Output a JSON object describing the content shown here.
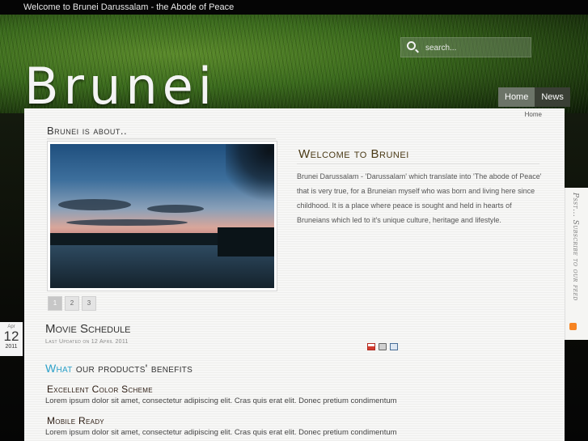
{
  "topbar": {
    "welcome": "Welcome to Brunei Darussalam - the Abode of Peace"
  },
  "header": {
    "logo": "Brunei"
  },
  "search": {
    "placeholder": "search..."
  },
  "nav": {
    "items": [
      {
        "label": "Home"
      },
      {
        "label": "News"
      }
    ]
  },
  "breadcrumb": {
    "current": "Home"
  },
  "about": {
    "title": "Brunei is about..",
    "pages": [
      "1",
      "2",
      "3"
    ]
  },
  "welcome": {
    "title": "Welcome to Brunei",
    "text": "Brunei Darussalam - 'Darussalam' which translate into 'The abode of Peace' that is very true, for a Bruneian myself who was born and living here since childhood. It is a place where peace is sought and held in hearts of Bruneians which led to it's unique culture, heritage and lifestyle."
  },
  "article": {
    "date": {
      "month": "Apr",
      "day": "12",
      "year": "2011"
    },
    "title": "Movie Schedule",
    "updated": "Last Updated on 12 April 2011",
    "icons": [
      "pdf-icon",
      "print-icon",
      "email-icon"
    ]
  },
  "benefits": {
    "title_accent": "What",
    "title_rest": " our products' benefits",
    "features": [
      {
        "title": "Excellent Color Scheme",
        "text": "Lorem ipsum dolor sit amet, consectetur adipiscing elit. Cras quis erat elit. Donec pretium condimentum"
      },
      {
        "title": "Mobile Ready",
        "text": "Lorem ipsum dolor sit amet, consectetur adipiscing elit. Cras quis erat elit. Donec pretium condimentum"
      }
    ]
  },
  "sidebar": {
    "rss_text": "Psst... Subscribe to our feed"
  }
}
